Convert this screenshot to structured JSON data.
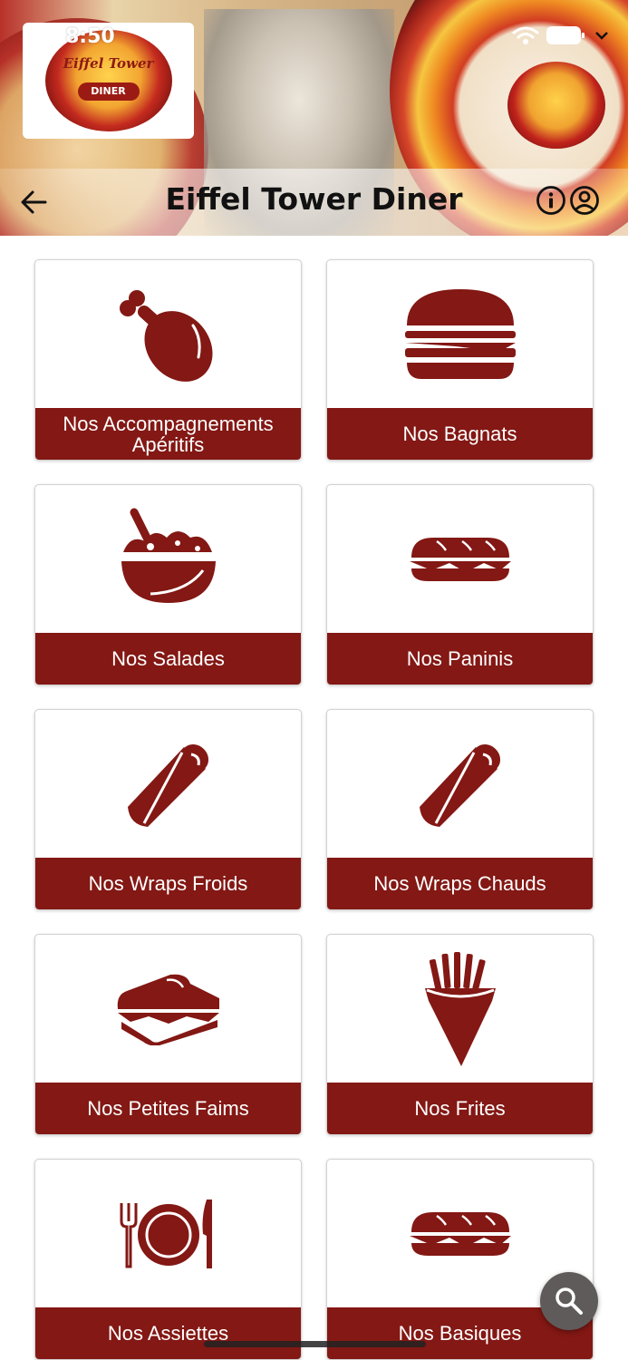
{
  "status_bar": {
    "time": "8:50"
  },
  "header": {
    "title": "Eiffel Tower Diner",
    "logo_text": "Eiffel Tower",
    "logo_sub": "DINER"
  },
  "colors": {
    "accent": "#831814",
    "fab": "#5f5b5a"
  },
  "categories": [
    {
      "label": "Nos Accompagnements Apéritifs",
      "icon": "drumstick-icon"
    },
    {
      "label": "Nos Bagnats",
      "icon": "burger-icon"
    },
    {
      "label": "Nos Salades",
      "icon": "salad-bowl-icon"
    },
    {
      "label": "Nos Paninis",
      "icon": "sub-sandwich-icon"
    },
    {
      "label": "Nos Wraps Froids",
      "icon": "wrap-icon"
    },
    {
      "label": "Nos Wraps Chauds",
      "icon": "wrap-icon"
    },
    {
      "label": "Nos Petites Faims",
      "icon": "toast-sandwich-icon"
    },
    {
      "label": "Nos Frites",
      "icon": "fries-cone-icon"
    },
    {
      "label": "Nos Assiettes",
      "icon": "plate-cutlery-icon"
    },
    {
      "label": "Nos Basiques",
      "icon": "sub-sandwich-icon"
    }
  ],
  "fab": {
    "icon": "search-icon"
  }
}
